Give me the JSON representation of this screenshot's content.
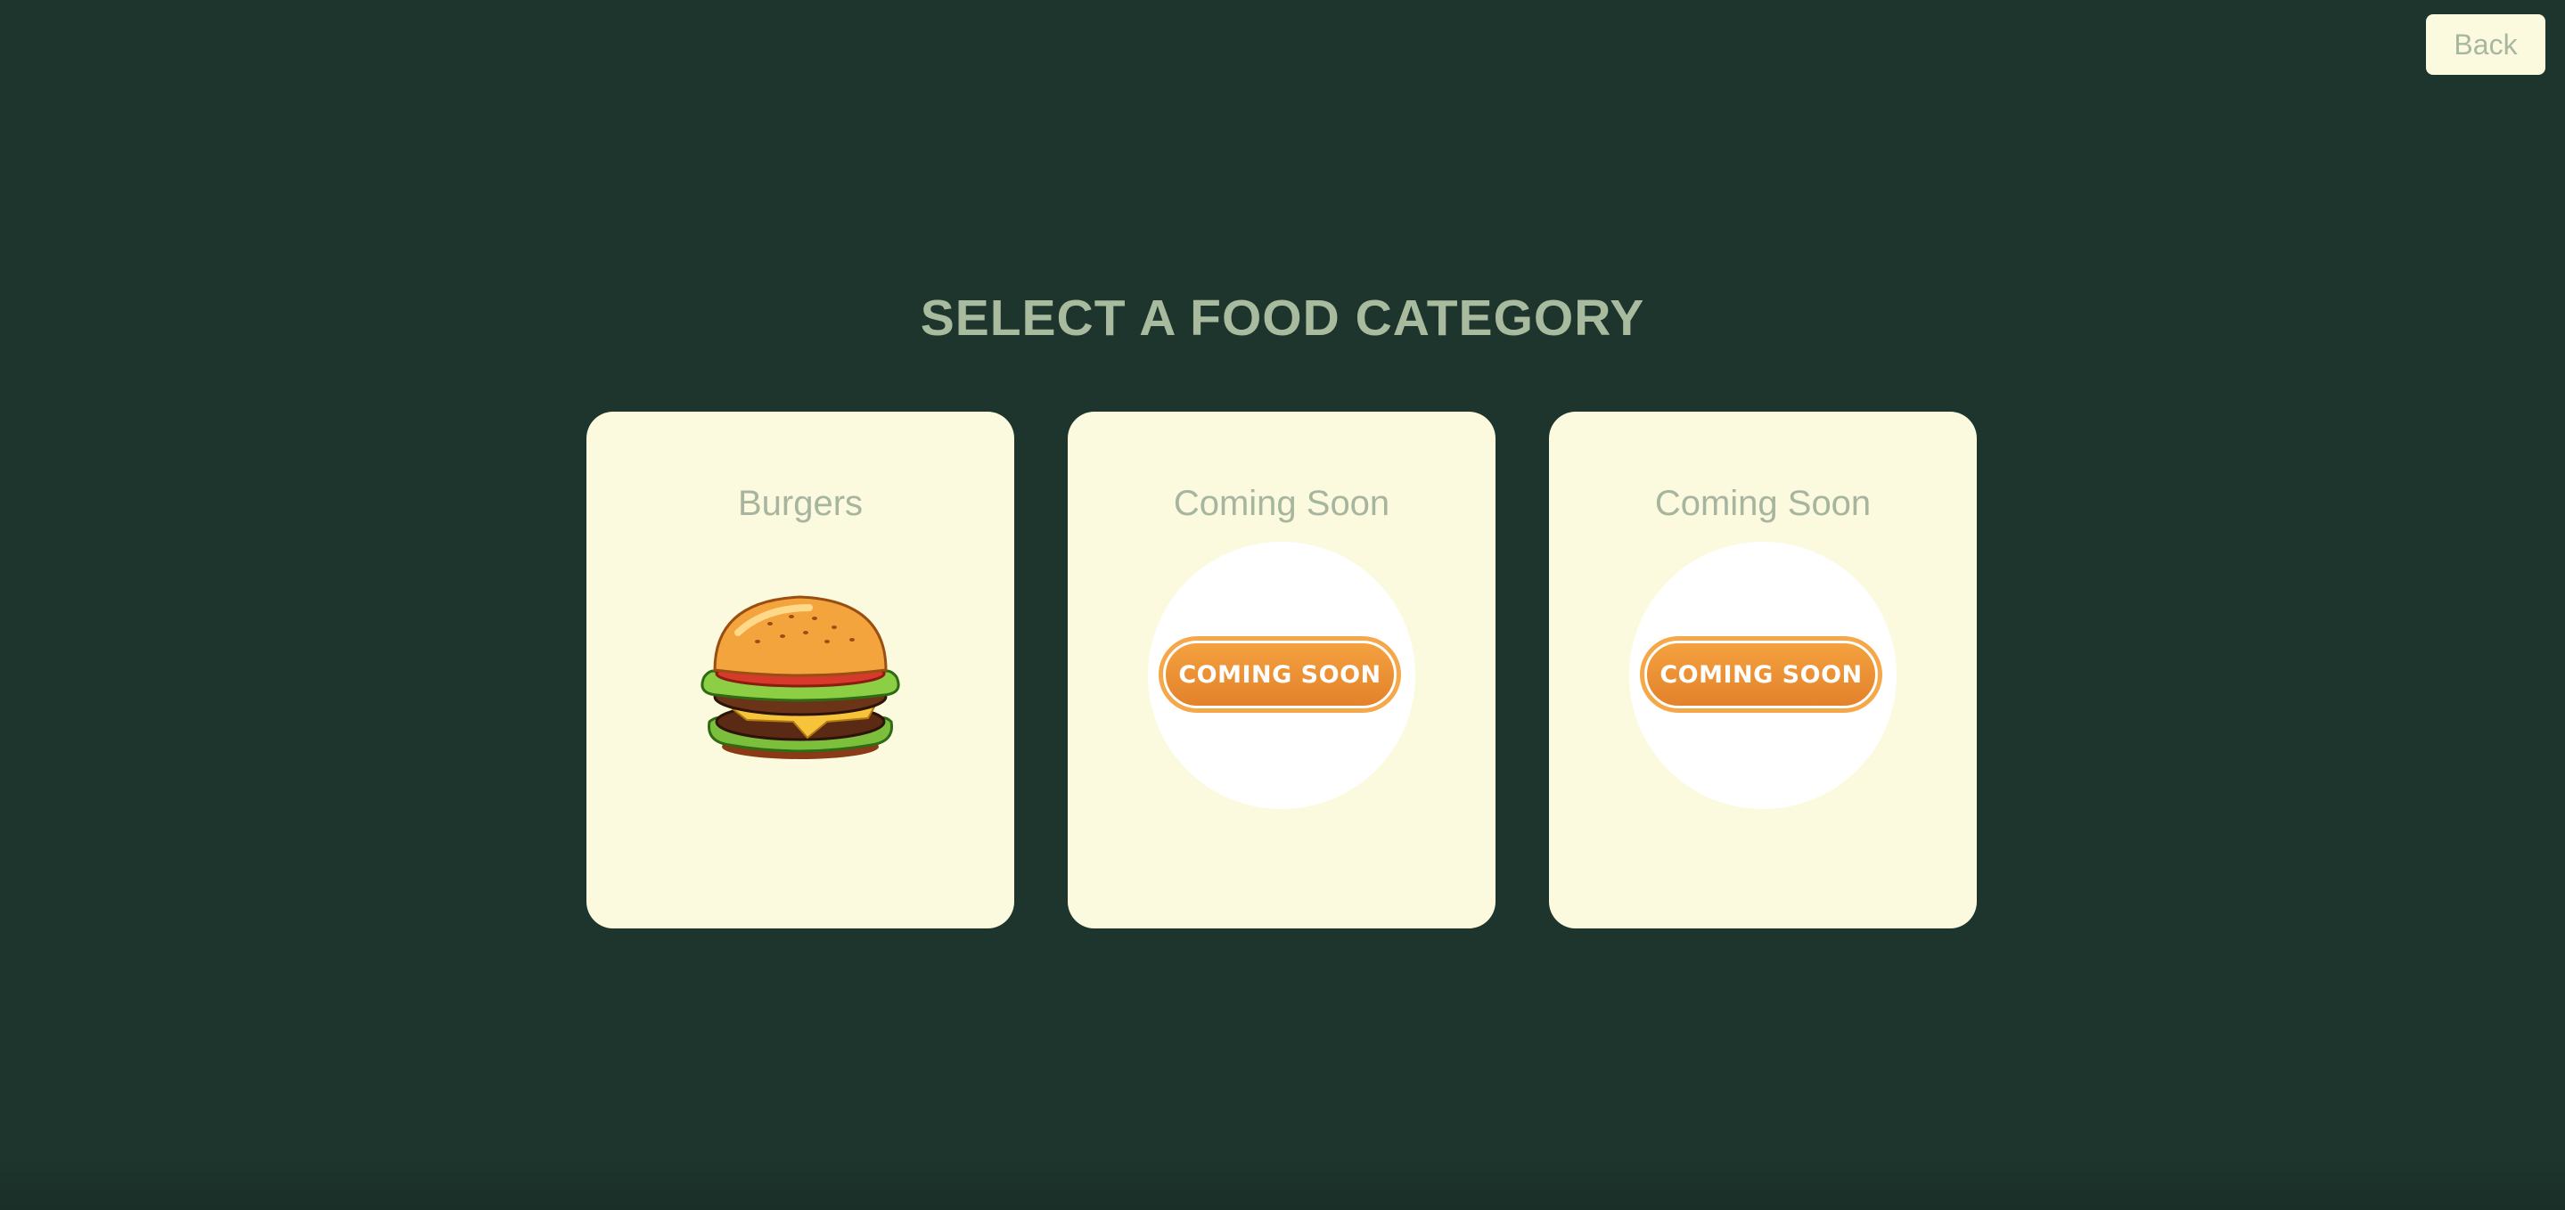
{
  "header": {
    "back_label": "Back"
  },
  "main": {
    "title": "SELECT A FOOD CATEGORY",
    "cards": [
      {
        "label": "Burgers",
        "image": "burger-illustration"
      },
      {
        "label": "Coming Soon",
        "badge": "COMING SOON"
      },
      {
        "label": "Coming Soon",
        "badge": "COMING SOON"
      }
    ]
  },
  "colors": {
    "background": "#1d352c",
    "card": "#fbfadf",
    "title_text": "#a9bb9f",
    "badge": "#f0953a"
  }
}
